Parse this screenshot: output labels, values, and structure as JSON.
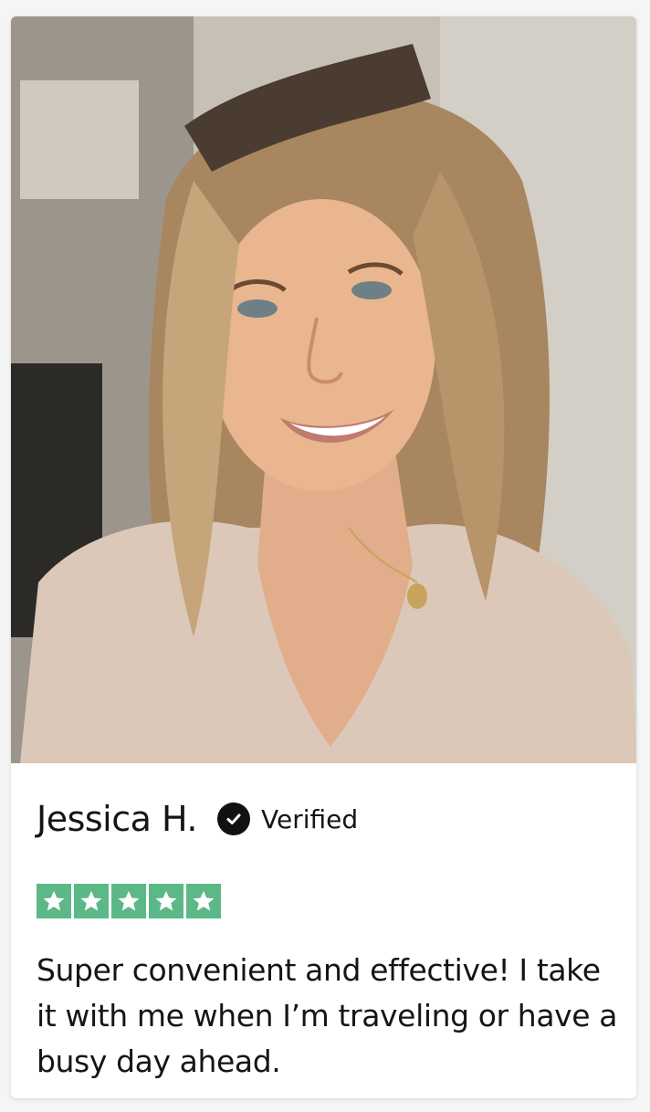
{
  "review": {
    "photo_description_icon": "reviewer-photo",
    "name": "Jessica H.",
    "verified_icon": "check-circle-icon",
    "verified_label": "Verified",
    "rating": {
      "value": 5,
      "max": 5,
      "star_color": "#5cb886"
    },
    "text": "Super convenient and effective! I take it with me when I’m traveling or have a busy day ahead."
  }
}
